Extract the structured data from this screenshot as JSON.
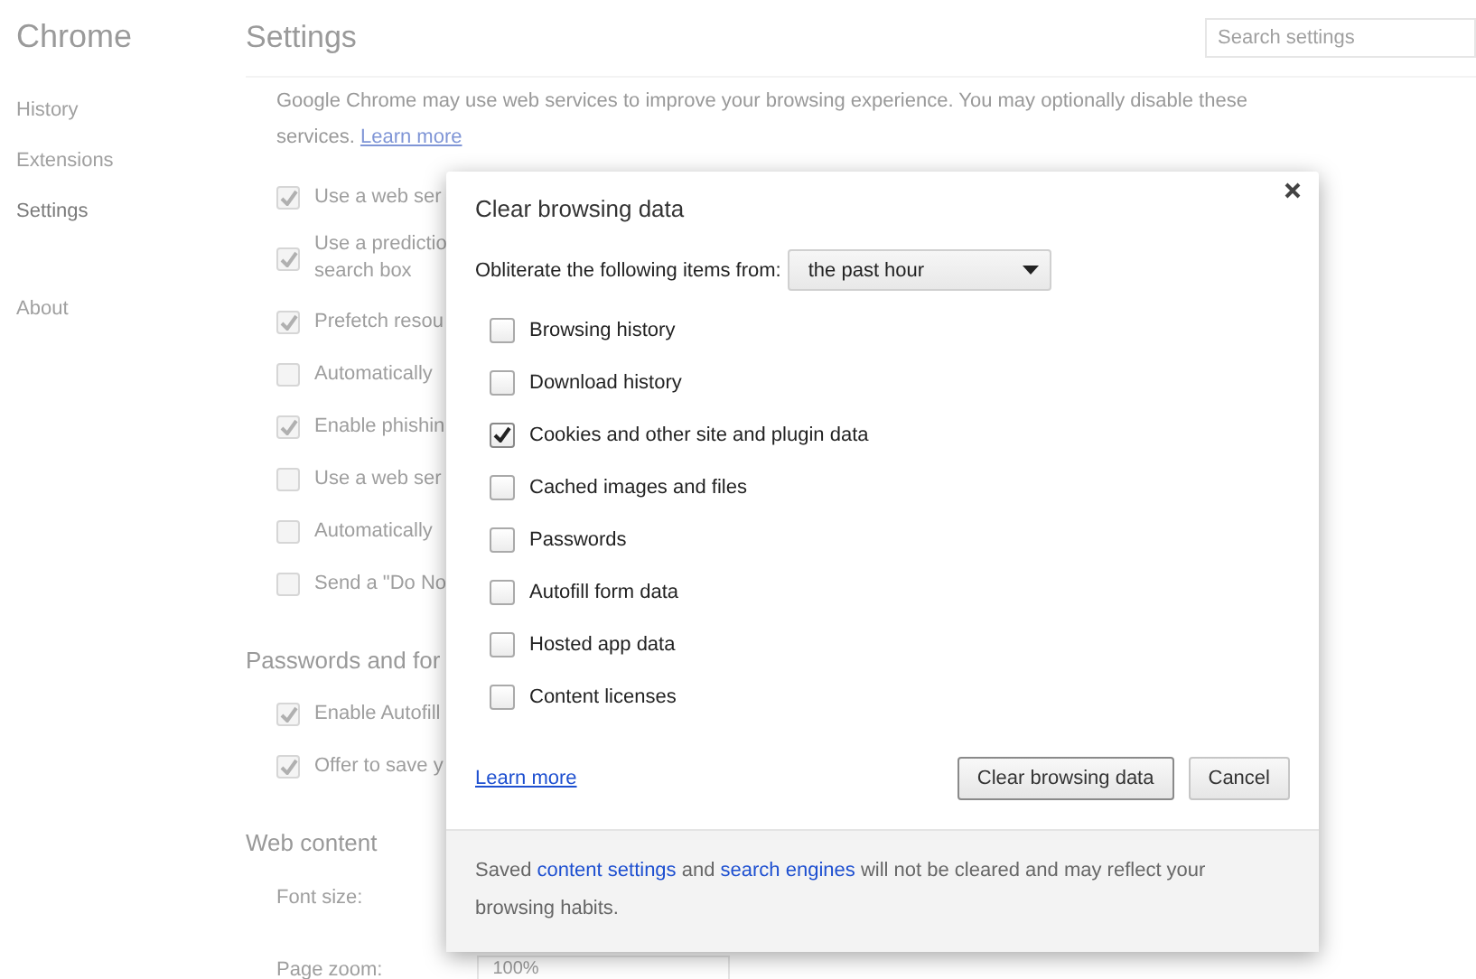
{
  "sidebar": {
    "title": "Chrome",
    "items": [
      {
        "label": "History",
        "selected": false
      },
      {
        "label": "Extensions",
        "selected": false
      },
      {
        "label": "Settings",
        "selected": true
      },
      {
        "label": "About",
        "selected": false
      }
    ]
  },
  "settings": {
    "title": "Settings",
    "search": {
      "placeholder": "Search settings"
    },
    "intro": "Google Chrome may use web services to improve your browsing experience. You may optionally disable these services.",
    "intro_link": "Learn more",
    "privacy_items": [
      {
        "lines": [
          "Use a web ser"
        ],
        "checked": true
      },
      {
        "lines": [
          "Use a predictio",
          "search box"
        ],
        "checked": true
      },
      {
        "lines": [
          "Prefetch resou"
        ],
        "checked": true
      },
      {
        "lines": [
          "Automatically"
        ],
        "checked": false
      },
      {
        "lines": [
          "Enable phishin"
        ],
        "checked": true
      },
      {
        "lines": [
          "Use a web ser"
        ],
        "checked": false
      },
      {
        "lines": [
          "Automatically"
        ],
        "checked": false
      },
      {
        "lines": [
          "Send a \"Do No"
        ],
        "checked": false
      }
    ],
    "passwords_heading": "Passwords and for",
    "password_items": [
      {
        "lines": [
          "Enable Autofill"
        ],
        "checked": true
      },
      {
        "lines": [
          "Offer to save y"
        ],
        "checked": true
      }
    ],
    "web_heading": "Web content",
    "font_size_label": "Font size:",
    "page_zoom_label": "Page zoom:",
    "page_zoom_value": "100%"
  },
  "dialog": {
    "title": "Clear browsing data",
    "range_label": "Obliterate the following items from:",
    "range_value": "the past hour",
    "items": [
      {
        "label": "Browsing history",
        "checked": false
      },
      {
        "label": "Download history",
        "checked": false
      },
      {
        "label": "Cookies and other site and plugin data",
        "checked": true
      },
      {
        "label": "Cached images and files",
        "checked": false
      },
      {
        "label": "Passwords",
        "checked": false
      },
      {
        "label": "Autofill form data",
        "checked": false
      },
      {
        "label": "Hosted app data",
        "checked": false
      },
      {
        "label": "Content licenses",
        "checked": false
      }
    ],
    "learn_more": "Learn more",
    "buttons": [
      {
        "label": "Clear browsing data",
        "kind": "default"
      },
      {
        "label": "Cancel",
        "kind": "plain"
      }
    ],
    "footer": {
      "before": "Saved ",
      "link1": "content settings",
      "middle": " and ",
      "link2": "search engines",
      "after": " will not be cleared and may reflect your browsing habits."
    }
  }
}
